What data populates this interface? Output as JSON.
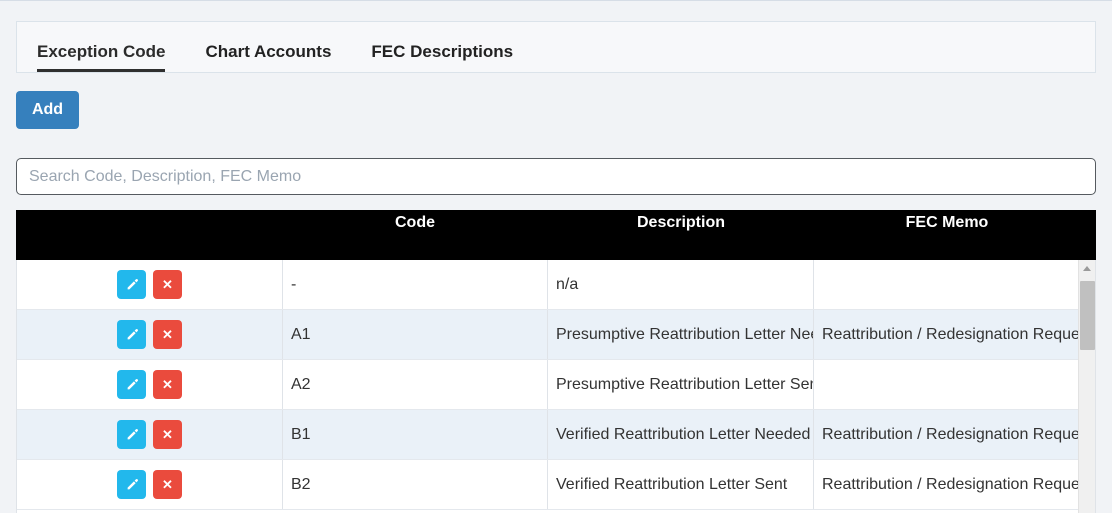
{
  "tabs": [
    {
      "label": "Exception Code",
      "active": true
    },
    {
      "label": "Chart Accounts",
      "active": false
    },
    {
      "label": "FEC Descriptions",
      "active": false
    }
  ],
  "toolbar": {
    "add_label": "Add"
  },
  "search": {
    "value": "",
    "placeholder": "Search Code, Description, FEC Memo"
  },
  "table": {
    "columns": [
      "",
      "Code",
      "Description",
      "FEC Memo"
    ],
    "rows": [
      {
        "code": "-",
        "description": "n/a",
        "fec_memo": ""
      },
      {
        "code": "A1",
        "description": "Presumptive Reattribution Letter Needed",
        "fec_memo": "Reattribution / Redesignation Requested"
      },
      {
        "code": "A2",
        "description": "Presumptive Reattribution Letter Sent",
        "fec_memo": ""
      },
      {
        "code": "B1",
        "description": "Verified Reattribution Letter Needed",
        "fec_memo": "Reattribution / Redesignation Requested"
      },
      {
        "code": "B2",
        "description": "Verified Reattribution Letter Sent",
        "fec_memo": "Reattribution / Redesignation Requested"
      }
    ],
    "row_actions": {
      "edit_icon": "pencil-icon",
      "delete_icon": "close-x-icon"
    }
  },
  "colors": {
    "add_button": "#3680bd",
    "edit_button": "#22b8ec",
    "delete_button": "#ea4b3d",
    "header_background": "#000000",
    "row_alt_background": "#eaf1f8",
    "page_background": "#f1f3f6"
  }
}
